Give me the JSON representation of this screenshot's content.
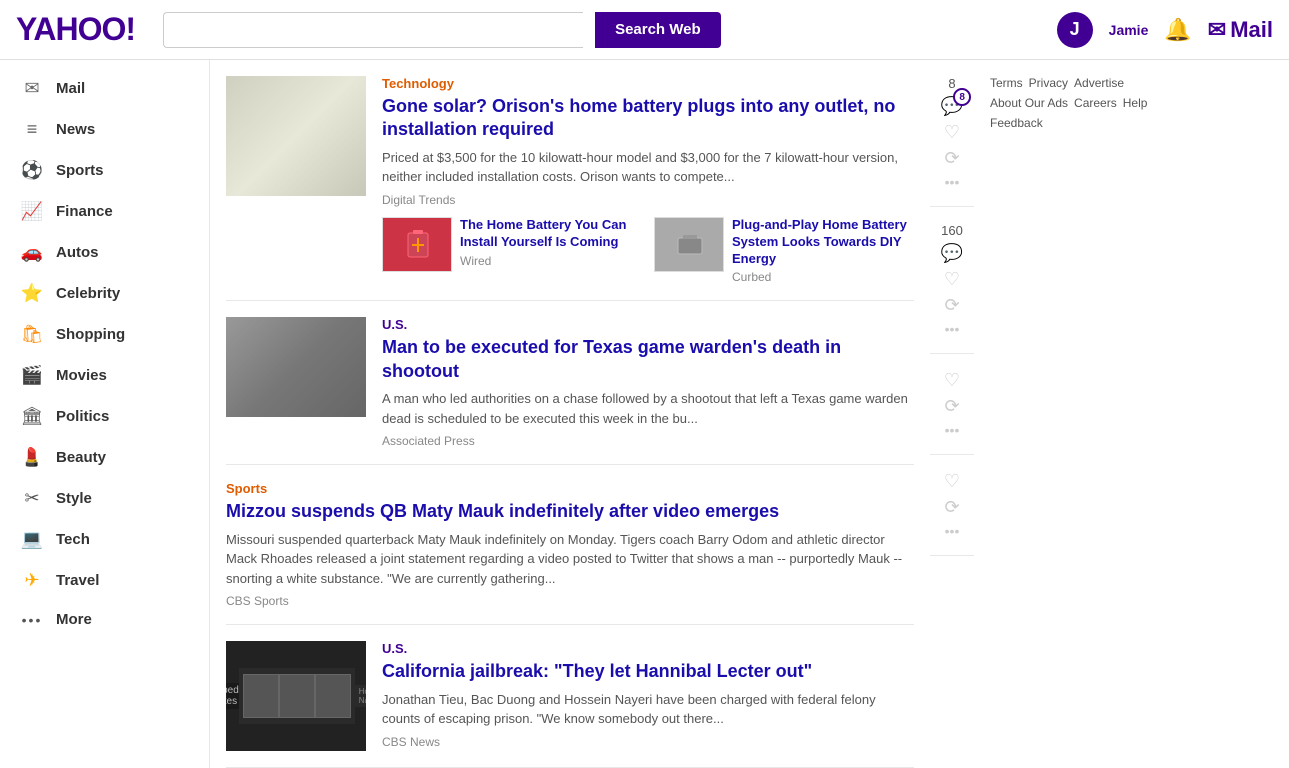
{
  "topbar": {
    "logo": "YAHOO!",
    "search_placeholder": "",
    "search_btn_label": "Search Web",
    "user_avatar_letter": "J",
    "username": "Jamie",
    "mail_label": "Mail"
  },
  "sidebar": {
    "items": [
      {
        "id": "mail",
        "label": "Mail",
        "icon": "✉",
        "color": "#6b6b6b"
      },
      {
        "id": "news",
        "label": "News",
        "icon": "📰",
        "color": "#6b6b6b"
      },
      {
        "id": "sports",
        "label": "Sports",
        "icon": "⚽",
        "color": "#ff6600"
      },
      {
        "id": "finance",
        "label": "Finance",
        "icon": "📈",
        "color": "#410093"
      },
      {
        "id": "autos",
        "label": "Autos",
        "icon": "🚗",
        "color": "#cc0000"
      },
      {
        "id": "celebrity",
        "label": "Celebrity",
        "icon": "⭐",
        "color": "#ff4500"
      },
      {
        "id": "shopping",
        "label": "Shopping",
        "icon": "🛍",
        "color": "#ff8800"
      },
      {
        "id": "movies",
        "label": "Movies",
        "icon": "🎬",
        "color": "#ffaa00"
      },
      {
        "id": "politics",
        "label": "Politics",
        "icon": "🏛",
        "color": "#555"
      },
      {
        "id": "beauty",
        "label": "Beauty",
        "icon": "💄",
        "color": "#cc3366"
      },
      {
        "id": "style",
        "label": "Style",
        "icon": "👗",
        "color": "#555"
      },
      {
        "id": "tech",
        "label": "Tech",
        "icon": "💻",
        "color": "#00aacc"
      },
      {
        "id": "travel",
        "label": "Travel",
        "icon": "✈",
        "color": "#ffaa00"
      },
      {
        "id": "more",
        "label": "More",
        "icon": "•••",
        "color": "#555"
      }
    ]
  },
  "articles": [
    {
      "id": "battery",
      "category": "Technology",
      "category_type": "tech",
      "title": "Gone solar? Orison's home battery plugs into any outlet, no installation required",
      "desc": "Priced at $3,500 for the 10 kilowatt-hour model and $3,000 for the 7 kilowatt-hour version, neither included installation costs. Orison wants to compete...",
      "source": "Digital Trends",
      "comment_count": "8",
      "has_image": true,
      "sub_articles": [
        {
          "title": "The Home Battery You Can Install Yourself Is Coming",
          "source": "Wired"
        },
        {
          "title": "Plug-and-Play Home Battery System Looks Towards DIY Energy",
          "source": "Curbed"
        }
      ]
    },
    {
      "id": "texas",
      "category": "U.S.",
      "category_type": "us",
      "title": "Man to be executed for Texas game warden's death in shootout",
      "desc": "A man who led authorities on a chase followed by a shootout that left a Texas game warden dead is scheduled to be executed this week in the bu...",
      "source": "Associated Press",
      "comment_count": "160",
      "has_image": true
    },
    {
      "id": "mizzou",
      "category": "Sports",
      "category_type": "sports",
      "title": "Mizzou suspends QB Maty Mauk indefinitely after video emerges",
      "desc": "Missouri suspended quarterback Maty Mauk indefinitely on Monday. Tigers coach Barry Odom and athletic director Mack Rhoades released a joint statement regarding a video posted to Twitter that shows a man -- purportedly Mauk -- snorting a white substance. \"We are currently gathering...",
      "source": "CBS Sports",
      "comment_count": "",
      "has_image": false
    },
    {
      "id": "jailbreak",
      "category": "U.S.",
      "category_type": "us",
      "title": "California jailbreak: \"They let Hannibal Lecter out\"",
      "desc": "Jonathan Tieu, Bac Duong and Hossein Nayeri have been charged with federal felony counts of escaping prison. \"We know somebody out there...",
      "source": "CBS News",
      "comment_count": "",
      "has_image": true,
      "breaking_news": true,
      "breaking_news_label": "BREAKING NEWS",
      "breaking_news_sublabel": "Escaped Inmates"
    }
  ],
  "footer": {
    "links": [
      "Terms",
      "Privacy",
      "Advertise",
      "About Our Ads",
      "Careers",
      "Help",
      "Feedback"
    ]
  },
  "icons": {
    "comment": "💬",
    "heart": "♡",
    "retweet": "⟳",
    "more": "•••"
  }
}
